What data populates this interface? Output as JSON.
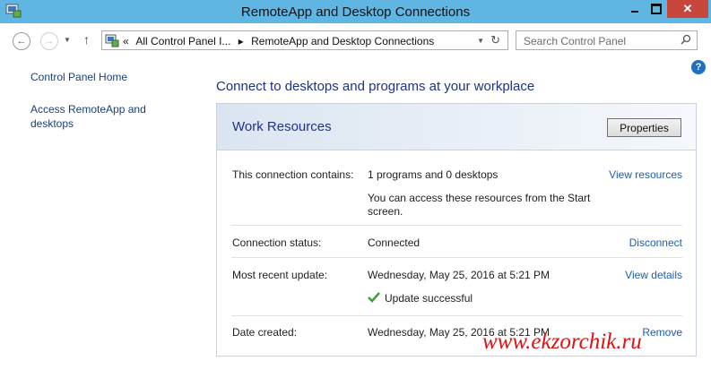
{
  "window": {
    "title": "RemoteApp and Desktop Connections",
    "close_label": "✕"
  },
  "address": {
    "overflow": "«",
    "crumbs": [
      "All Control Panel I...",
      "▸",
      "RemoteApp and Desktop Connections"
    ]
  },
  "search": {
    "placeholder": "Search Control Panel"
  },
  "sidebar": {
    "links": [
      "Control Panel Home",
      "Access RemoteApp and desktops"
    ]
  },
  "main": {
    "heading": "Connect to desktops and programs at your workplace",
    "panel": {
      "title": "Work Resources",
      "properties_label": "Properties",
      "rows": {
        "contains": {
          "label": "This connection contains:",
          "value": "1 programs and 0 desktops",
          "note": "You can access these resources from the Start screen.",
          "link": "View resources"
        },
        "status": {
          "label": "Connection status:",
          "value": "Connected",
          "link": "Disconnect"
        },
        "update": {
          "label": "Most recent update:",
          "value": "Wednesday, May 25, 2016 at 5:21 PM",
          "result": "Update successful",
          "link": "View details"
        },
        "created": {
          "label": "Date created:",
          "value": "Wednesday, May 25, 2016 at 5:21 PM",
          "link": "Remove"
        }
      }
    }
  },
  "watermark": "www.ekzorchik.ru",
  "colors": {
    "titlebar": "#5fb6e3",
    "link": "#1a5fb4",
    "heading": "#1e3287",
    "close": "#c7473d"
  }
}
